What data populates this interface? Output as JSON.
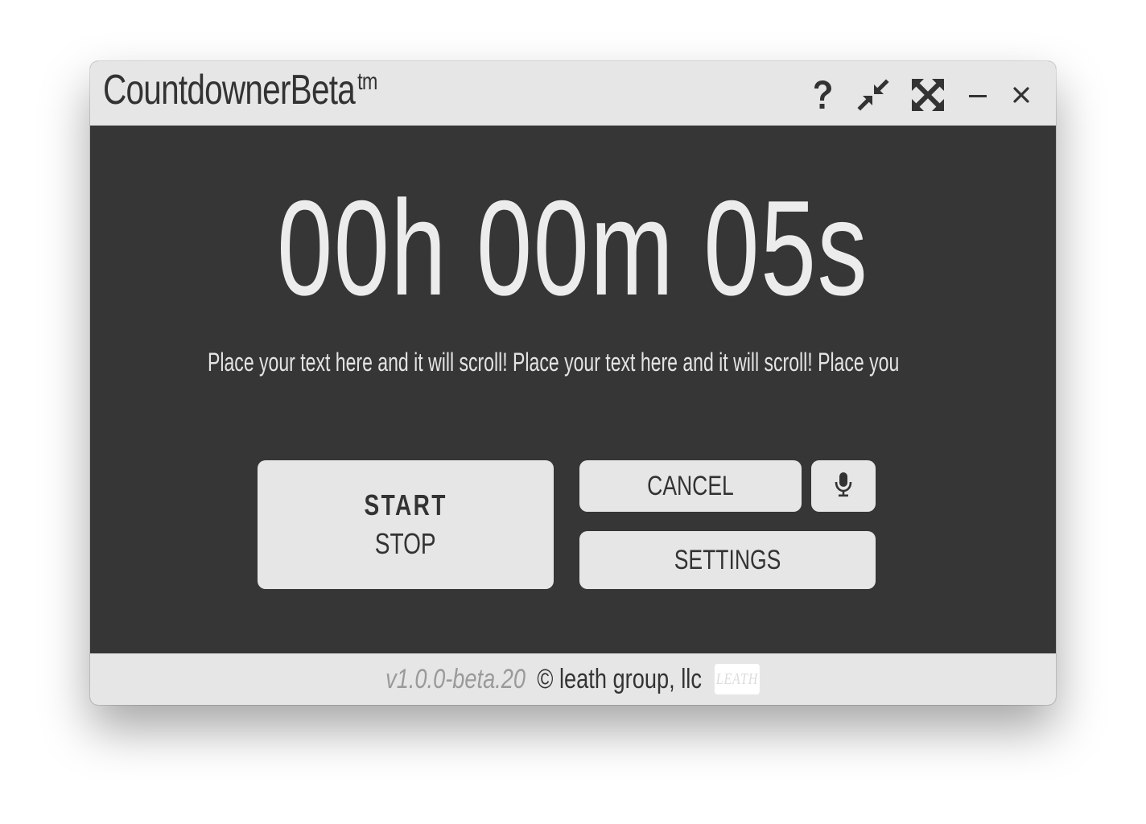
{
  "app": {
    "title": "CountdownerBeta",
    "trademark": "tm"
  },
  "titlebar": {
    "icons": [
      "help-icon",
      "compress-icon",
      "expand-icon",
      "minimize-icon",
      "close-icon"
    ]
  },
  "timer": {
    "display": "00h 00m 05s",
    "hours": 0,
    "minutes": 0,
    "seconds": 5
  },
  "scroll_text": "Place your text here and it will scroll! Place your text here and it will scroll! Place you",
  "controls": {
    "start_label": "START",
    "stop_label": "STOP",
    "cancel_label": "CANCEL",
    "settings_label": "SETTINGS",
    "mic_icon": "microphone-icon"
  },
  "footer": {
    "version": "v1.0.0-beta.20",
    "copyright": "© leath group, llc",
    "logo_text": "LEATH"
  },
  "colors": {
    "background": "#363636",
    "panel": "#e6e6e6",
    "text_dark": "#333333",
    "text_light": "#ececec"
  }
}
